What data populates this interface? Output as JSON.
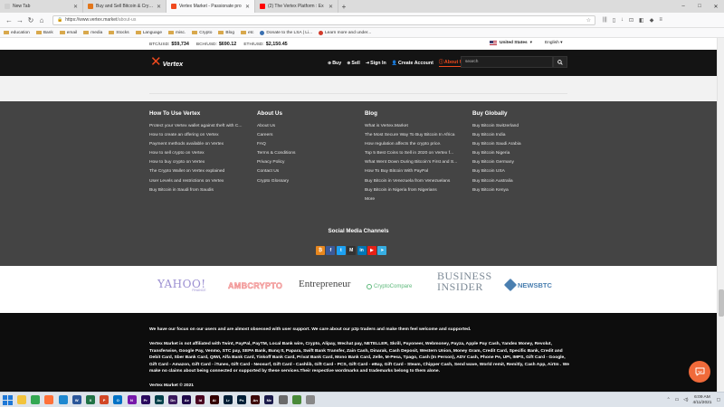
{
  "browser": {
    "tabs": [
      {
        "label": "New Tab",
        "favicon_color": "#cfcfcf",
        "active": false
      },
      {
        "label": "Buy and Sell Bitcoin & Crypto",
        "favicon_color": "#e2761b",
        "active": false
      },
      {
        "label": "Vertex Market - Passionate pro",
        "favicon_color": "#f04a1e",
        "active": true
      },
      {
        "label": "(2) The Vertex Platform : Ex",
        "favicon_color": "#ff0000",
        "active": false
      }
    ],
    "url_host": "https://www.vertex.market",
    "url_path": "/about-us",
    "bookmarks": [
      {
        "label": "education",
        "type": "folder"
      },
      {
        "label": "Bank",
        "type": "folder"
      },
      {
        "label": "email",
        "type": "folder"
      },
      {
        "label": "media",
        "type": "folder"
      },
      {
        "label": "Stocks",
        "type": "folder"
      },
      {
        "label": "Language",
        "type": "folder"
      },
      {
        "label": "misc.",
        "type": "folder"
      },
      {
        "label": "Crypto",
        "type": "folder"
      },
      {
        "label": "Blog",
        "type": "folder"
      },
      {
        "label": "etc",
        "type": "folder"
      },
      {
        "label": "Donate to the LSA | Li...",
        "type": "site",
        "color": "#3a6fb0"
      },
      {
        "label": "Learn more and under...",
        "type": "site",
        "color": "#d23a2a"
      }
    ]
  },
  "ticker": [
    {
      "pair": "BTC/USD:",
      "price": "$59,734"
    },
    {
      "pair": "BCH/USD:",
      "price": "$690.12"
    },
    {
      "pair": "ETH/USD:",
      "price": "$2,150.45"
    }
  ],
  "region": {
    "country": "United States",
    "language": "English"
  },
  "site": {
    "logo_text": "Vertex",
    "brand_color": "#f04a1e",
    "nav": [
      {
        "label": "Buy",
        "icon": "plus-icon"
      },
      {
        "label": "Sell",
        "icon": "plus-icon"
      },
      {
        "label": "Sign In",
        "icon": "signin-icon"
      },
      {
        "label": "Create Account",
        "icon": "person-icon"
      },
      {
        "label": "About Us",
        "icon": "info-icon",
        "active": true
      }
    ],
    "search_placeholder": "search"
  },
  "footer": {
    "columns": [
      {
        "title": "How To Use Vertex",
        "items": [
          "Protect your Vertex wallet against theft with C...",
          "How to create an offering on Vertex",
          "Payment methods available on Vertex",
          "How to sell crypto on Vertex",
          "How to buy crypto on Vertex",
          "The Crypto Wallet on Vertex explained",
          "User Levels and restrictions on Vertex",
          "Buy Bitcoin in Saudi from Saudis"
        ]
      },
      {
        "title": "About Us",
        "items": [
          "About Us",
          "Careers",
          "FAQ",
          "Terms & Conditions",
          "Privacy Policy",
          "Contact Us",
          "Crypto Glossary"
        ]
      },
      {
        "title": "Blog",
        "items": [
          "What is Vertex.Market",
          "The Most Secure Way To Buy Bitcoin In Africa",
          "How regulation affects the crypto price.",
          "Top 5 Best Coins to Sell in 2020 on Vertex f...",
          "What Went Down During Bitcoin's First and S...",
          "How To Buy Bitcoin With PayPal",
          "Buy Bitcoin in Venezuela from Venezuelans",
          "Buy Bitcoin in Nigeria from Nigerians",
          "More"
        ]
      },
      {
        "title": "Buy Globally",
        "items": [
          "Buy Bitcoin Switzerland",
          "Buy Bitcoin India",
          "Buy Bitcoin Saudi Arabia",
          "Buy Bitcoin Nigeria",
          "Buy Bitcoin Germany",
          "Buy Bitcoin USA",
          "Buy Bitcoin Australia",
          "Buy Bitcoin Kenya"
        ]
      }
    ],
    "social_title": "Social Media Channels",
    "social": [
      {
        "name": "bitcointalk-icon",
        "glyph": "₿",
        "color": "#e8871e"
      },
      {
        "name": "facebook-icon",
        "glyph": "f",
        "color": "#3b5998"
      },
      {
        "name": "twitter-icon",
        "glyph": "t",
        "color": "#1da1f2"
      },
      {
        "name": "medium-icon",
        "glyph": "M",
        "color": "#333333"
      },
      {
        "name": "linkedin-icon",
        "glyph": "in",
        "color": "#0077b5"
      },
      {
        "name": "youtube-icon",
        "glyph": "▶",
        "color": "#e62117"
      },
      {
        "name": "telegram-icon",
        "glyph": "➤",
        "color": "#37aee2"
      }
    ]
  },
  "partners": [
    {
      "name": "yahoo-finance-logo",
      "text": "YAHOO!",
      "sub": "FINANCE",
      "color": "#9b8fd1"
    },
    {
      "name": "ambcrypto-logo",
      "text": "AMBCRYPTO",
      "color": "#f08a8a"
    },
    {
      "name": "entrepreneur-logo",
      "text": "Entrepreneur",
      "color": "#444444"
    },
    {
      "name": "cryptocompare-logo",
      "text": "CryptoCompare",
      "color": "#5cb87a"
    },
    {
      "name": "business-insider-logo",
      "text": "BUSINESS",
      "text2": "INSIDER",
      "color": "#7d8a96"
    },
    {
      "name": "newsbtc-logo",
      "text": "NEWSBTC",
      "color": "#4a7fb0"
    }
  ],
  "legal": {
    "p1": "We have our focus on our users and are almost obsessed with user support. We care about our p2p traders and make them feel welcome and supported.",
    "p2": "Vertex Market is not affiliated with Twint, PayPal, PayTM, Local Bank wire, Crypto, Alipay, Wechat pay, NETELLER, Skrill, Payoneer, Webmoney, Payza, Apple Pay Cash, Yandex Money, Revolut, Transferwise, Google Pay, Venmo, STC pay, SEPA Bank, Bunq It, Papara, Swift Bank Transfer, Zain Cash, Dinarak, Cash Deposit, Western Union, Money Gram, Credit Card, Specific Bank, Credit and Debit Card, Sber Bank Card, QIWI, Alfa Bank Card, Tinkoff Bank Card, Privat Bank Card, Mono Bank Card, Zelle, M-Pesa, Tpago, Cash (In Person), ADV Cash, Phone Pe, UPI, IMPS, Gift Card - Google, Gift Card - Amazon, Gift Card - iTunes, Gift Card - Neosurf, Gift Card - Cashlib, Gift Card - PCS, Gift Card - eBay, Gift Card - Steam, Chipper Cash, Send wave, World remit, Remitly, Cash App, Airtm . We make no claims about being connected or supported by these services.Their respective wordmarks and trademarks belong to them alone.",
    "copyright": "Vertex Market © 2021"
  },
  "taskbar": {
    "apps": [
      {
        "name": "file-explorer-icon",
        "color": "#f2c33c",
        "glyph": ""
      },
      {
        "name": "chrome-icon",
        "color": "#34a853",
        "glyph": ""
      },
      {
        "name": "firefox-icon",
        "color": "#ff7139",
        "glyph": ""
      },
      {
        "name": "edge-icon",
        "color": "#1e88d0",
        "glyph": ""
      },
      {
        "name": "word-icon",
        "color": "#2b579a",
        "glyph": "W"
      },
      {
        "name": "excel-icon",
        "color": "#217346",
        "glyph": "X"
      },
      {
        "name": "powerpoint-icon",
        "color": "#d24726",
        "glyph": "P"
      },
      {
        "name": "outlook-icon",
        "color": "#0072c6",
        "glyph": "O"
      },
      {
        "name": "onenote-icon",
        "color": "#7719aa",
        "glyph": "N"
      },
      {
        "name": "premiere-icon",
        "color": "#2a0a5e",
        "glyph": "Pr"
      },
      {
        "name": "audition-icon",
        "color": "#00404a",
        "glyph": "Au"
      },
      {
        "name": "dimension-icon",
        "color": "#3b1a5e",
        "glyph": "Dn"
      },
      {
        "name": "after-effects-icon",
        "color": "#1f0a4a",
        "glyph": "Ae"
      },
      {
        "name": "indesign-icon",
        "color": "#49021f",
        "glyph": "Id"
      },
      {
        "name": "illustrator-icon",
        "color": "#330000",
        "glyph": "Ai"
      },
      {
        "name": "lightroom-icon",
        "color": "#001e36",
        "glyph": "Lr"
      },
      {
        "name": "photoshop-icon",
        "color": "#001e36",
        "glyph": "Ps"
      },
      {
        "name": "animate-icon",
        "color": "#3d0a0a",
        "glyph": "An"
      },
      {
        "name": "media-encoder-icon",
        "color": "#1a1a4a",
        "glyph": "Me"
      },
      {
        "name": "app-icon",
        "color": "#6a6a6a",
        "glyph": ""
      },
      {
        "name": "app-icon-2",
        "color": "#4a8a3a",
        "glyph": ""
      },
      {
        "name": "app-icon-3",
        "color": "#888888",
        "glyph": ""
      }
    ],
    "time": "6:09 AM",
    "date": "4/11/2021"
  }
}
